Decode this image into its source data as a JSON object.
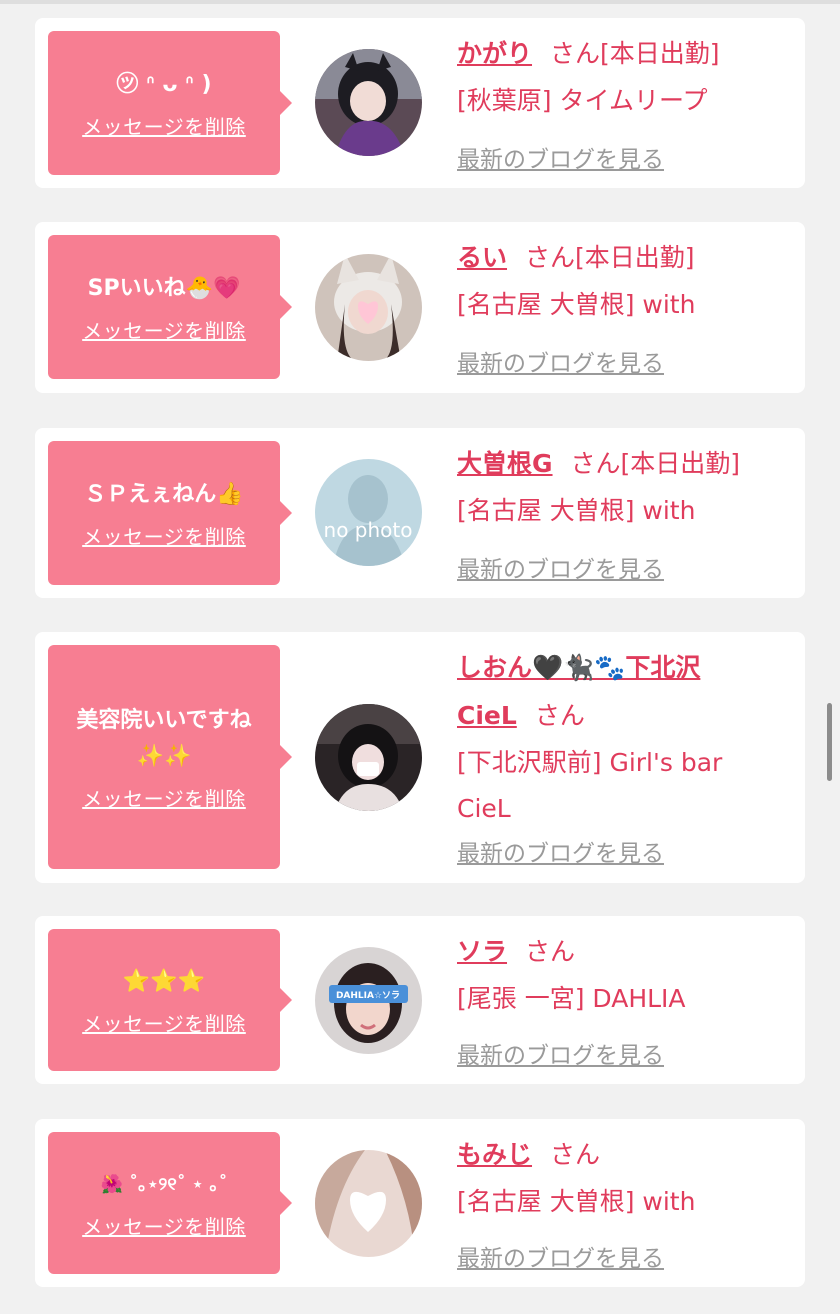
{
  "delete_label": "メッセージを削除",
  "san_label": "さん",
  "blog_label": "最新のブログを見る",
  "items": [
    {
      "message": "㋡ ᐢ ᴗ ᐢ )",
      "name": "かがり",
      "status": "[本日出勤]",
      "shop": "[秋葉原] タイムリープ"
    },
    {
      "message": "SPいいね🐣💗",
      "name": "るい",
      "status": "[本日出勤]",
      "shop": "[名古屋 大曽根] with"
    },
    {
      "message": "ＳＰえぇねん👍",
      "name": "大曽根G",
      "status": "[本日出勤]",
      "shop": "[名古屋 大曽根] with"
    },
    {
      "message": "美容院いいですね✨✨",
      "name": "しおん🖤🐈‍⬛🐾下北沢CieL",
      "status": "",
      "shop": "[下北沢駅前] Girl's bar CieL"
    },
    {
      "message": "⭐⭐⭐",
      "name": "ソラ",
      "status": "",
      "shop": "[尾張 一宮] DAHLIA"
    },
    {
      "message": "🌺 ˚｡⋆୨୧˚ ⋆ ｡˚",
      "name": "もみじ",
      "status": "",
      "shop": "[名古屋 大曽根] with"
    }
  ],
  "avatar_texts": {
    "no_photo": "no photo",
    "sora_badge": "DAHLIA☆ソラ"
  },
  "colors": {
    "bubble": "#f77e92",
    "name": "#e03c5c",
    "link_gray": "#9a9a9a",
    "background": "#f1f1f1"
  }
}
